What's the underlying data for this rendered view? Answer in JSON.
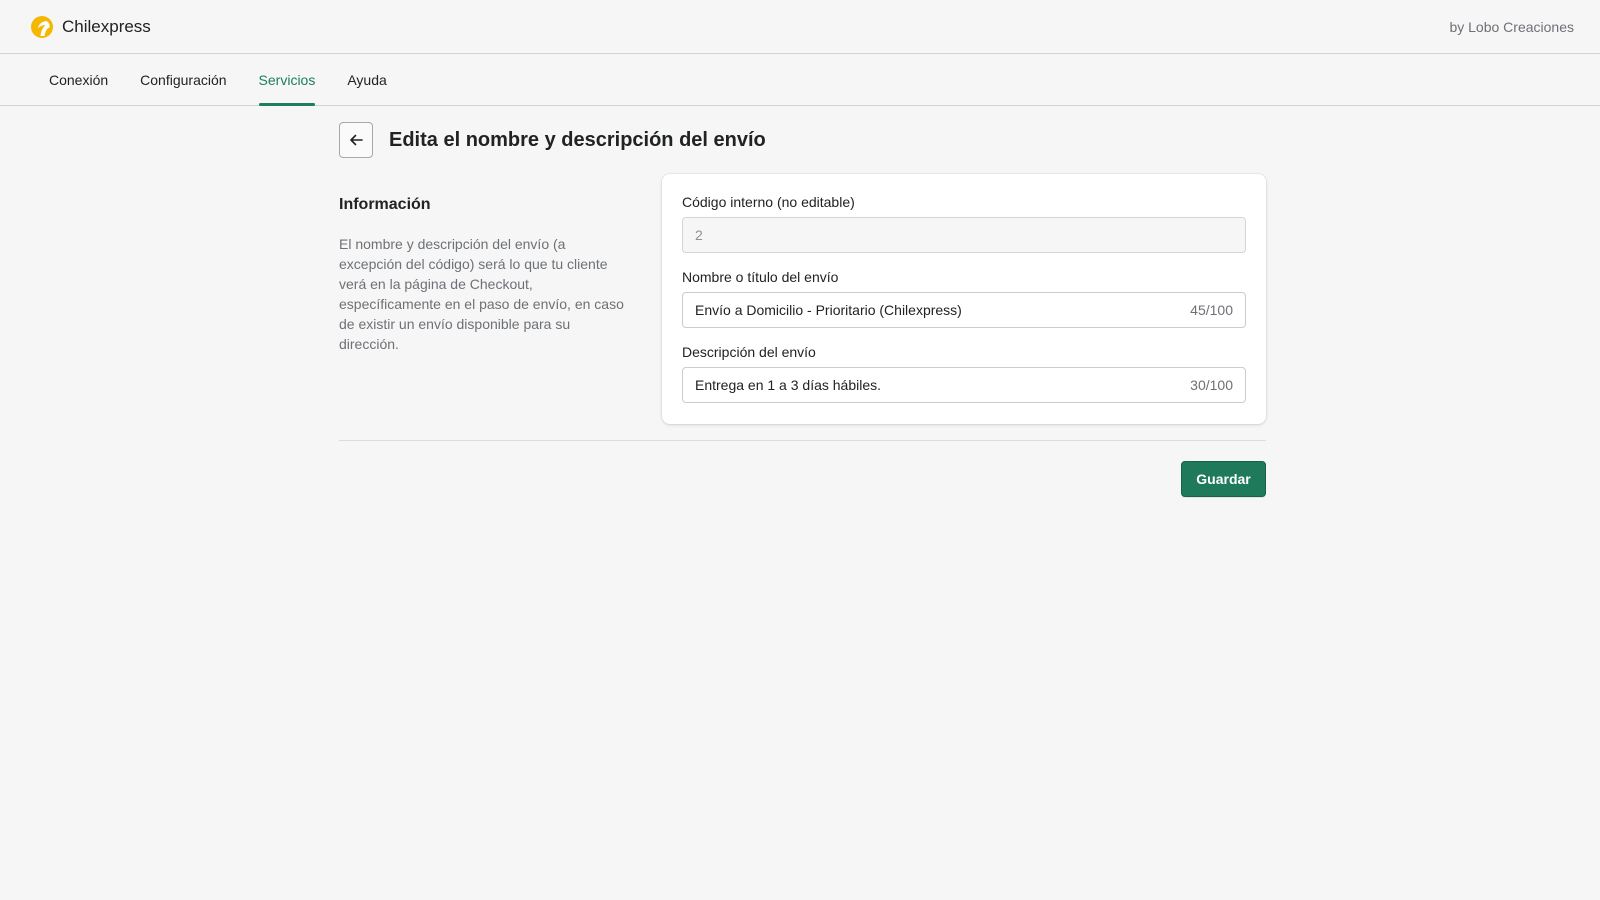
{
  "app": {
    "brand_name": "Chilexpress",
    "byline": "by Lobo Creaciones"
  },
  "tabs": [
    {
      "label": "Conexión",
      "active": false
    },
    {
      "label": "Configuración",
      "active": false
    },
    {
      "label": "Servicios",
      "active": true
    },
    {
      "label": "Ayuda",
      "active": false
    }
  ],
  "page": {
    "title": "Edita el nombre y descripción del envío"
  },
  "info": {
    "title": "Información",
    "text": "El nombre y descripción del envío (a excepción del código) será lo que tu cliente verá en la página de Checkout, específicamente en el paso de envío, en caso de existir un envío disponible para su dirección."
  },
  "form": {
    "code": {
      "label": "Código interno (no editable)",
      "value": "2"
    },
    "name": {
      "label": "Nombre o título del envío",
      "value": "Envío a Domicilio - Prioritario (Chilexpress)",
      "counter": "45/100"
    },
    "description": {
      "label": "Descripción del envío",
      "value": "Entrega en 1 a 3 días hábiles.",
      "counter": "30/100"
    }
  },
  "actions": {
    "save_label": "Guardar"
  },
  "colors": {
    "accent": "#1a7f5a",
    "brand_logo": "#f5b700"
  },
  "icons": {
    "logo": "chilexpress-logo-icon",
    "back": "arrow-left-icon"
  }
}
